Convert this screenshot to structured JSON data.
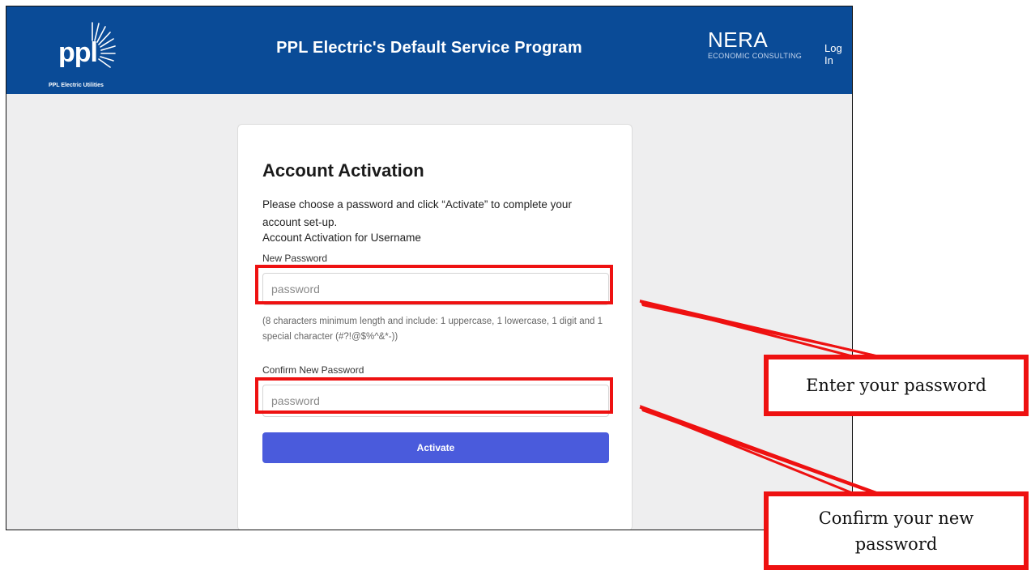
{
  "header": {
    "logo_text": "ppl",
    "logo_sub": "PPL Electric Utilities",
    "title": "PPL Electric's Default Service Program",
    "partner_name": "NERA",
    "partner_sub": "ECONOMIC CONSULTING",
    "login_label": "Log In",
    "bg_color": "#0a4b97"
  },
  "form": {
    "title": "Account Activation",
    "intro": "Please choose a password and click “Activate” to complete your account set-up.",
    "activation_for": "Account Activation for Username",
    "new_password_label": "New Password",
    "new_password_placeholder": "password",
    "hint": "(8 characters minimum length and include: 1 uppercase, 1 lowercase, 1 digit and 1 special character (#?!@$%^&*-))",
    "confirm_password_label": "Confirm New Password",
    "confirm_password_placeholder": "password",
    "activate_label": "Activate",
    "button_color": "#4a5bdc"
  },
  "callouts": {
    "enter_password": "Enter your password",
    "confirm_password": "Confirm your new password",
    "highlight_color": "#ee1111"
  }
}
